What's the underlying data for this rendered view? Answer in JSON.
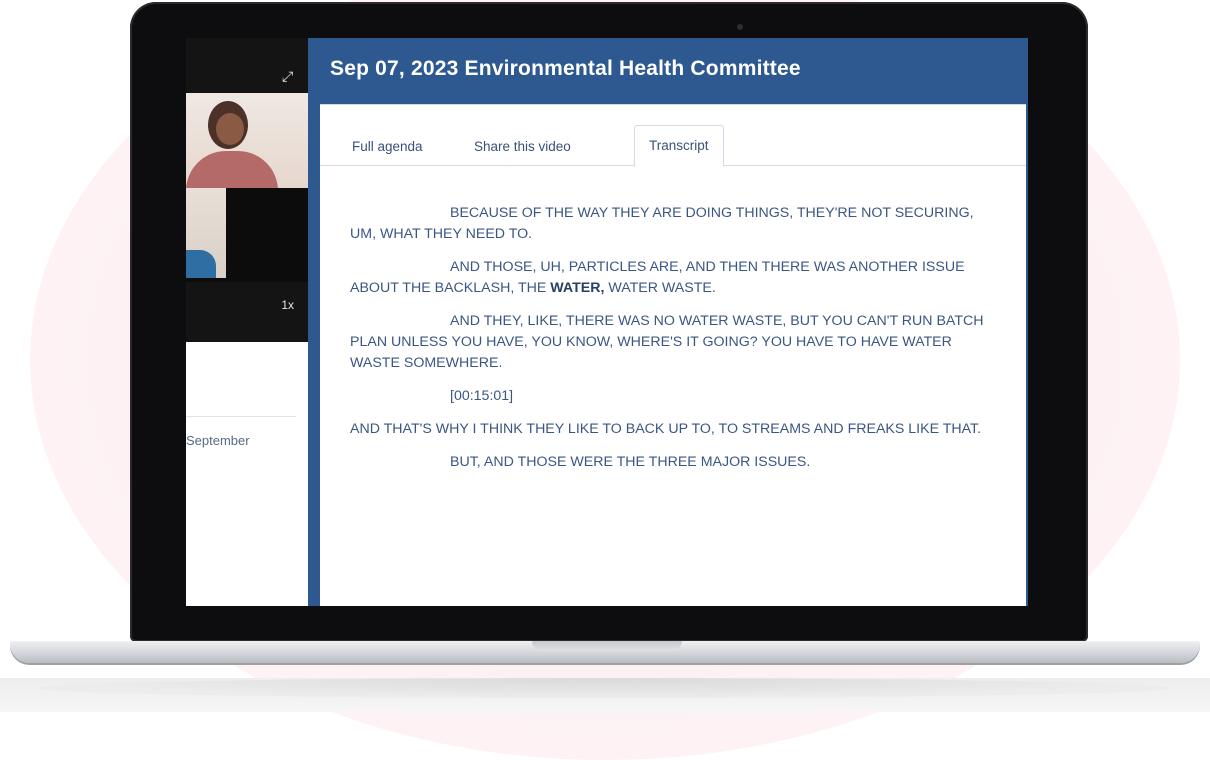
{
  "header": {
    "meeting_title": "Sep 07, 2023 Environmental Health Committee"
  },
  "tabs": [
    {
      "label": "Full agenda",
      "active": false
    },
    {
      "label": "Share this video",
      "active": false
    },
    {
      "label": "Transcript",
      "active": true
    }
  ],
  "video": {
    "speed_label": "1x",
    "expand_icon": "expand-arrows-icon"
  },
  "sidebar": {
    "meeting_month": "September"
  },
  "transcript": {
    "p1": "BECAUSE OF THE WAY THEY ARE DOING THINGS, THEY'RE NOT SECURING, UM, WHAT THEY NEED TO.",
    "p2_before": "AND THOSE, UH, PARTICLES ARE, AND THEN THERE WAS ANOTHER ISSUE ABOUT THE BACKLASH, THE ",
    "p2_bold": "WATER,",
    "p2_after": " WATER WASTE.",
    "p3": "AND THEY, LIKE, THERE WAS NO WATER WASTE, BUT YOU CAN'T RUN BATCH PLAN UNLESS YOU HAVE, YOU KNOW, WHERE'S IT GOING? YOU HAVE TO HAVE WATER WASTE SOMEWHERE.",
    "timestamp": "[00:15:01]",
    "p4": "AND THAT'S WHY I THINK THEY LIKE TO BACK UP TO, TO STREAMS AND FREAKS LIKE THAT.",
    "p5": "BUT, AND THOSE WERE THE THREE MAJOR ISSUES."
  },
  "colors": {
    "header_blue": "#2d5890",
    "text_blue": "#3a5683",
    "background_pink": "#fbe9ec"
  }
}
